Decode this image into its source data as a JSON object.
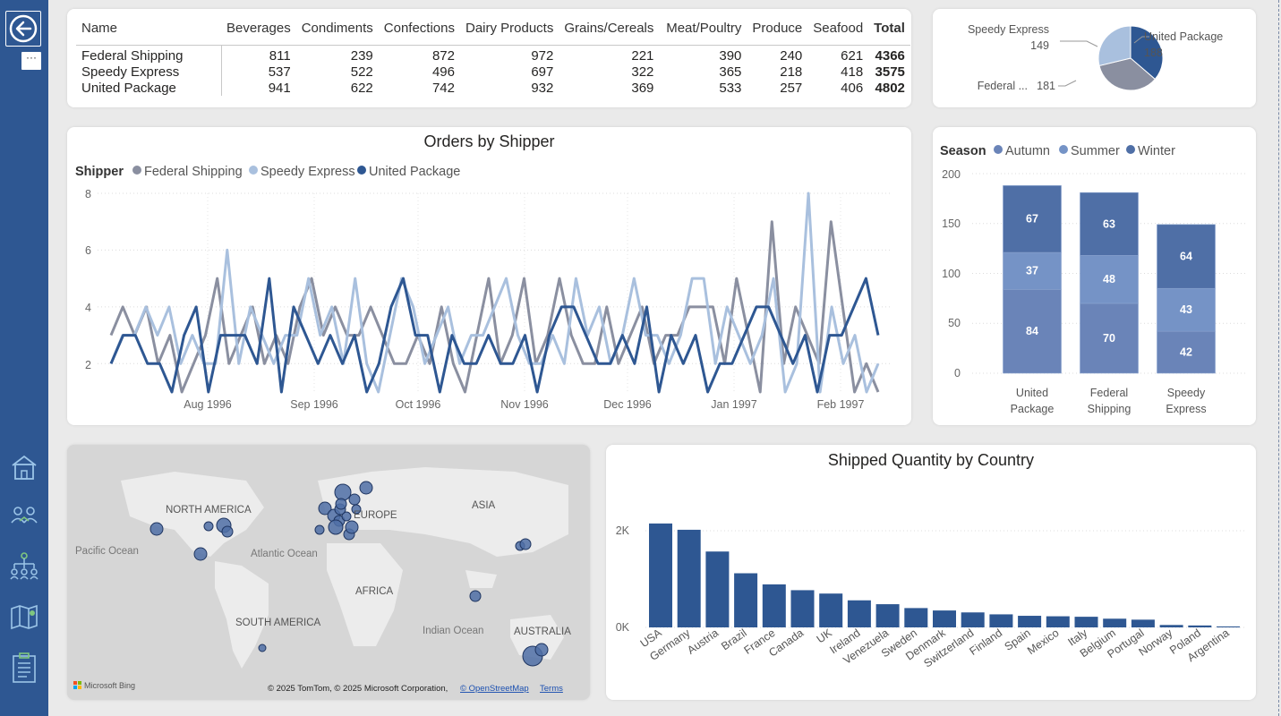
{
  "nav": {
    "back_icon": "back-arrow-icon",
    "more_label": "···",
    "items": [
      "home-icon",
      "users-icon",
      "hierarchy-icon",
      "map-icon",
      "clipboard-icon"
    ]
  },
  "colors": {
    "sidebar": "#2e5792",
    "federal": "#8a8fa0",
    "speedy": "#a9c0de",
    "united": "#2e5792",
    "autumn": "#6a84b8",
    "summer": "#7593c6",
    "winter": "#4f6fa6",
    "bar": "#2e5792"
  },
  "matrix": {
    "columns": [
      "Name",
      "Beverages",
      "Condiments",
      "Confections",
      "Dairy Products",
      "Grains/Cereals",
      "Meat/Poultry",
      "Produce",
      "Seafood",
      "Total"
    ],
    "rows": [
      {
        "name": "Federal Shipping",
        "values": [
          "811",
          "239",
          "872",
          "972",
          "221",
          "390",
          "240",
          "621"
        ],
        "total": "4366"
      },
      {
        "name": "Speedy Express",
        "values": [
          "537",
          "522",
          "496",
          "697",
          "322",
          "365",
          "218",
          "418"
        ],
        "total": "3575"
      },
      {
        "name": "United Package",
        "values": [
          "941",
          "622",
          "742",
          "932",
          "369",
          "533",
          "257",
          "406"
        ],
        "total": "4802"
      }
    ]
  },
  "pie": {
    "labels": [
      {
        "name": "Speedy Express",
        "value": "149"
      },
      {
        "name": "United Package",
        "value": "188"
      },
      {
        "name": "Federal ...",
        "value": "181"
      }
    ]
  },
  "line_chart": {
    "title": "Orders by Shipper",
    "legend_title": "Shipper",
    "legend": [
      "Federal Shipping",
      "Speedy Express",
      "United Package"
    ],
    "yticks": [
      "8",
      "6",
      "4",
      "2"
    ],
    "xticks": [
      "Aug 1996",
      "Sep 1996",
      "Oct 1996",
      "Nov 1996",
      "Dec 1996",
      "Jan 1997",
      "Feb 1997"
    ]
  },
  "season_chart": {
    "legend_title": "Season",
    "legend": [
      "Autumn",
      "Summer",
      "Winter"
    ],
    "yticks": [
      "200",
      "150",
      "100",
      "50",
      "0"
    ],
    "categories": [
      "United Package",
      "Federal Shipping",
      "Speedy Express"
    ],
    "cat_lines": [
      [
        "United",
        "Package"
      ],
      [
        "Federal",
        "Shipping"
      ],
      [
        "Speedy",
        "Express"
      ]
    ]
  },
  "map": {
    "labels": [
      "NORTH AMERICA",
      "EUROPE",
      "ASIA",
      "Pacific Ocean",
      "Atlantic Ocean",
      "AFRICA",
      "SOUTH AMERICA",
      "Indian Ocean",
      "AUSTRALIA"
    ],
    "bing": "Microsoft Bing",
    "copyright": "© 2025 TomTom, © 2025 Microsoft Corporation,",
    "osm_link": "© OpenStreetMap",
    "terms_link": "Terms"
  },
  "country_chart": {
    "title": "Shipped Quantity by Country",
    "yticks": [
      "2K",
      "0K"
    ]
  },
  "chart_data": [
    {
      "type": "pie",
      "title": "",
      "categories": [
        "United Package",
        "Federal Shipping",
        "Speedy Express"
      ],
      "values": [
        188,
        181,
        149
      ]
    },
    {
      "type": "line",
      "title": "Orders by Shipper",
      "ylim": [
        1,
        8
      ],
      "x": [
        "1996-07",
        "1996-08",
        "1996-09",
        "1996-10",
        "1996-11",
        "1996-12",
        "1997-01",
        "1997-02"
      ],
      "series": [
        {
          "name": "Federal Shipping",
          "values": [
            3,
            4,
            3,
            4,
            2,
            3,
            1,
            2,
            3,
            5,
            2,
            3,
            4,
            2,
            3,
            2,
            4,
            5,
            3,
            4,
            3,
            3,
            4,
            3,
            2,
            2,
            3,
            2,
            4,
            2,
            1,
            3,
            5,
            2,
            3,
            5,
            2,
            3,
            5,
            3,
            2,
            2,
            4,
            2,
            3,
            4,
            2,
            3,
            3,
            4,
            4,
            4,
            2,
            5,
            3,
            1,
            7,
            2,
            4,
            3,
            2,
            7,
            4,
            1,
            2,
            1
          ]
        },
        {
          "name": "Speedy Express",
          "values": [
            2,
            3,
            3,
            4,
            3,
            4,
            2,
            3,
            2,
            2,
            6,
            2,
            4,
            3,
            2,
            3,
            3,
            5,
            3,
            4,
            2,
            5,
            2,
            1,
            3,
            5,
            4,
            2,
            3,
            4,
            2,
            3,
            3,
            4,
            5,
            3,
            2,
            2,
            3,
            2,
            5,
            3,
            4,
            2,
            3,
            5,
            3,
            3,
            2,
            3,
            5,
            5,
            2,
            4,
            3,
            2,
            3,
            5,
            1,
            2,
            8,
            1,
            4,
            2,
            3,
            1,
            2
          ]
        },
        {
          "name": "United Package",
          "values": [
            2,
            3,
            3,
            2,
            2,
            1,
            3,
            4,
            1,
            3,
            3,
            3,
            2,
            5,
            1,
            4,
            3,
            2,
            3,
            2,
            3,
            1,
            2,
            4,
            5,
            3,
            3,
            1,
            3,
            2,
            2,
            3,
            2,
            2,
            3,
            1,
            3,
            4,
            4,
            3,
            2,
            2,
            3,
            2,
            4,
            1,
            3,
            2,
            3,
            1,
            2,
            2,
            3,
            4,
            4,
            3,
            2,
            3,
            1,
            3,
            3,
            4,
            5,
            3
          ]
        }
      ]
    },
    {
      "type": "bar",
      "stacked": true,
      "title": "",
      "categories": [
        "United Package",
        "Federal Shipping",
        "Speedy Express"
      ],
      "ylim": [
        0,
        200
      ],
      "series": [
        {
          "name": "Autumn",
          "values": [
            84,
            70,
            42
          ]
        },
        {
          "name": "Summer",
          "values": [
            37,
            48,
            43
          ]
        },
        {
          "name": "Winter",
          "values": [
            67,
            63,
            64
          ]
        }
      ]
    },
    {
      "type": "bar",
      "title": "Shipped Quantity by Country",
      "categories": [
        "USA",
        "Germany",
        "Austria",
        "Brazil",
        "France",
        "Canada",
        "UK",
        "Ireland",
        "Venezuela",
        "Sweden",
        "Denmark",
        "Switzerland",
        "Finland",
        "Spain",
        "Mexico",
        "Italy",
        "Belgium",
        "Portugal",
        "Norway",
        "Poland",
        "Argentina"
      ],
      "values": [
        2150,
        2020,
        1570,
        1120,
        890,
        770,
        700,
        560,
        480,
        400,
        350,
        310,
        270,
        240,
        230,
        220,
        180,
        160,
        50,
        40,
        20
      ],
      "ylim": [
        0,
        2500
      ]
    }
  ]
}
